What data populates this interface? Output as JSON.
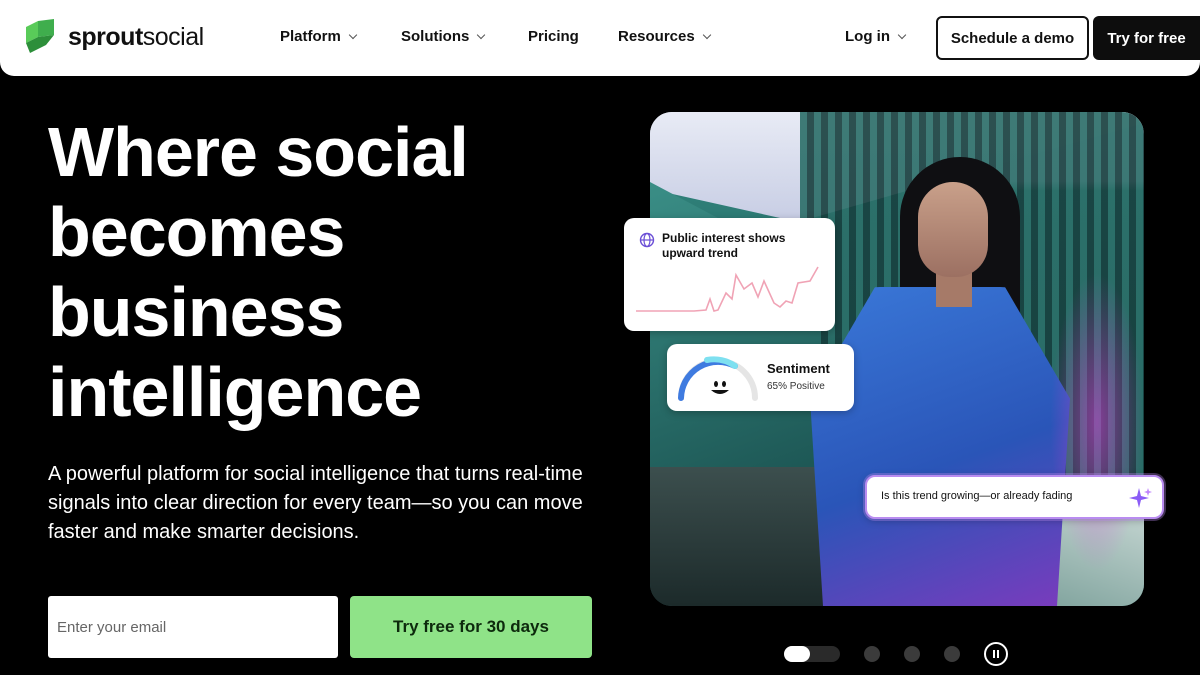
{
  "brand": {
    "name_bold": "sprout",
    "name_regular": "social",
    "accent": "#59cb59"
  },
  "nav": {
    "items": [
      {
        "label": "Platform",
        "dropdown": true
      },
      {
        "label": "Solutions",
        "dropdown": true
      },
      {
        "label": "Pricing",
        "dropdown": false
      },
      {
        "label": "Resources",
        "dropdown": true
      }
    ],
    "login": "Log in",
    "demo": "Schedule a demo",
    "try": "Try for free"
  },
  "hero": {
    "title_lines": [
      "Where social",
      "becomes",
      "business",
      "intelligence"
    ],
    "subtitle": "A powerful platform for social intelligence that turns real-time signals into clear direction for every team—so you can move faster and make smarter decisions.",
    "email_placeholder": "Enter your email",
    "cta": "Try free for 30 days",
    "cta_color": "#8fe388"
  },
  "cards": {
    "trend": {
      "text": "Public interest shows upward trend",
      "icon": "globe-icon"
    },
    "sentiment": {
      "title": "Sentiment",
      "value": "65% Positive",
      "positive_pct": 65
    },
    "ask": {
      "text": "Is this trend growing—or already fading",
      "icon": "sparkle-icon"
    }
  },
  "carousel": {
    "slides": 4,
    "active": 1,
    "control": "pause-icon"
  }
}
